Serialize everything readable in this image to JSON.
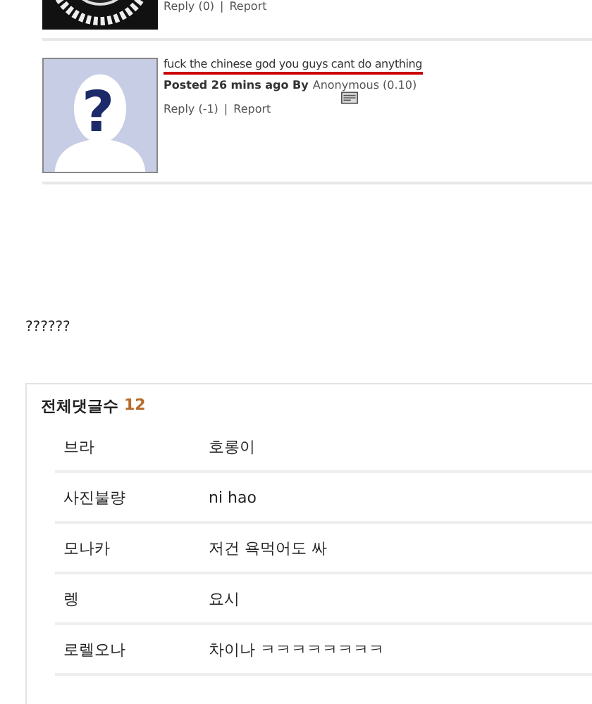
{
  "comments": [
    {
      "links": [
        "Reply (0)",
        "Report"
      ],
      "separator": "|"
    },
    {
      "avatar": {
        "kind": "placeholder",
        "symbol": "?"
      },
      "text": "fuck the chinese god you guys cant do anything",
      "posted_label": "Posted 26 mins ago By",
      "author": "Anonymous (0.10)",
      "links": [
        "Reply (-1)",
        "Report"
      ],
      "separator": "|"
    }
  ],
  "body_text": "??????",
  "comment_list": {
    "title": "전체댓글수",
    "count": "12",
    "rows": [
      {
        "name": "브라",
        "text": "호롱이"
      },
      {
        "name": "사진불량",
        "text": "ni hao"
      },
      {
        "name": "모나카",
        "text": "저건 욕먹어도 싸"
      },
      {
        "name": "렝",
        "text": "요시"
      },
      {
        "name": "로렐오나",
        "text": "차이나 ㅋㅋㅋㅋㅋㅋㅋㅋ"
      }
    ]
  }
}
